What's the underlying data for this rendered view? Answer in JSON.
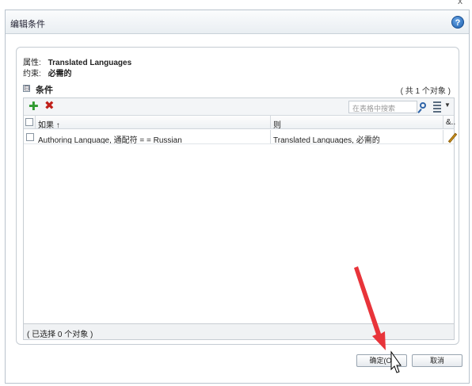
{
  "window": {
    "close_glyph": "x"
  },
  "dialog": {
    "title": "编辑条件",
    "help_icon": "?"
  },
  "attributes": {
    "property_label": "属性:",
    "property_value": "Translated Languages",
    "constraint_label": "约束:",
    "constraint_value": "必需的"
  },
  "section": {
    "toggle": "⊟",
    "title": "条件",
    "count": "( 共 1 个对象 )"
  },
  "toolbar": {
    "add_icon": "add-icon",
    "delete_icon": "delete-icon",
    "search_placeholder": "在表格中搜索",
    "columns_dropdown": "▼"
  },
  "table": {
    "columns": [
      "如果  ↑",
      "则",
      "&..."
    ],
    "rows": [
      {
        "if": "Authoring Language, 通配符 = = Russian",
        "then": "Translated Languages, 必需的"
      }
    ]
  },
  "status": "( 已选择 0 个对象 )",
  "buttons": {
    "ok": "确定(O)",
    "cancel": "取消"
  },
  "colors": {
    "accent_arrow": "#e8343a",
    "add_green": "#2f9a2f",
    "delete_red": "#c0201a"
  }
}
